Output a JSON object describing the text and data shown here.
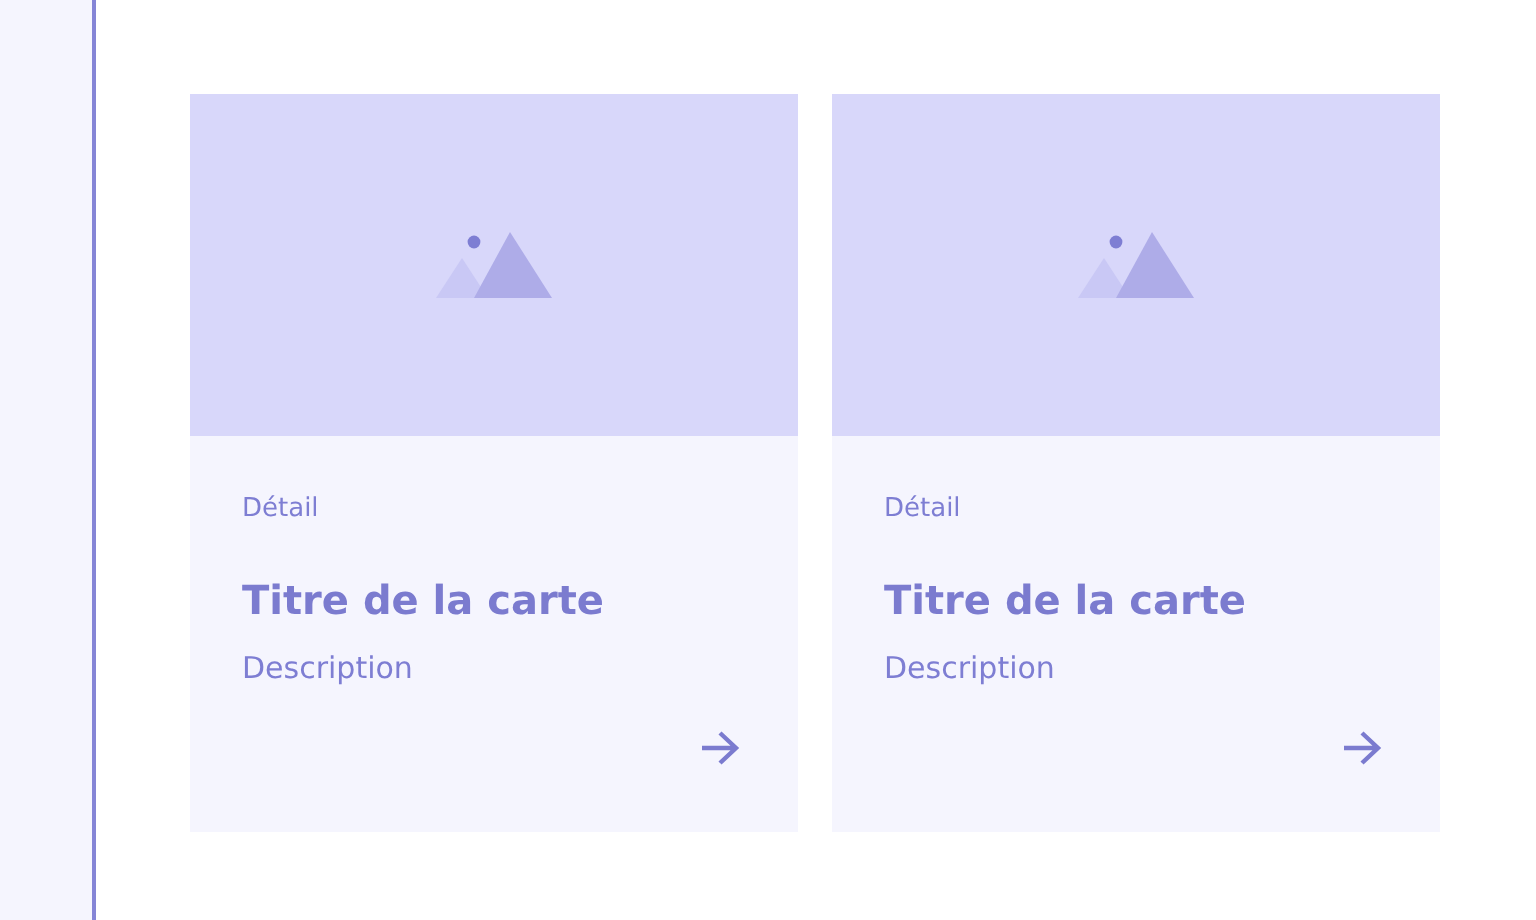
{
  "cards": [
    {
      "detail": "Détail",
      "title": "Titre de la carte",
      "description": "Description"
    },
    {
      "detail": "Détail",
      "title": "Titre de la carte",
      "description": "Description"
    }
  ]
}
